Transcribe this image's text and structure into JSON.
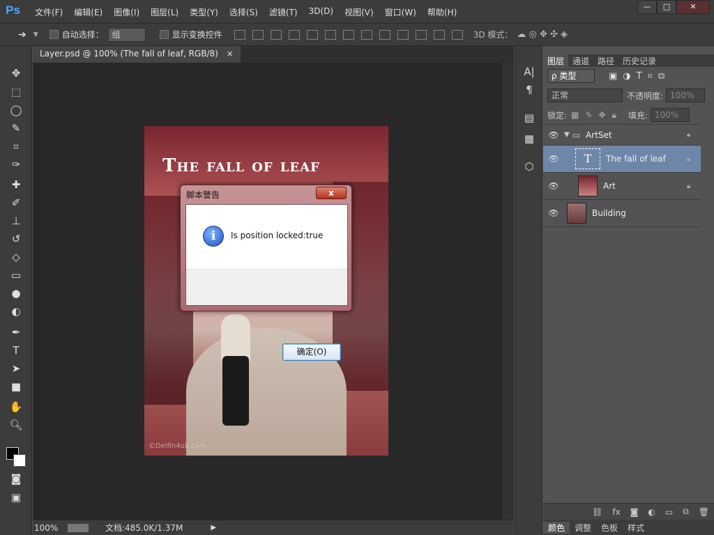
{
  "app": {
    "logo": "Ps"
  },
  "menu": [
    "文件(F)",
    "编辑(E)",
    "图像(I)",
    "图层(L)",
    "类型(Y)",
    "选择(S)",
    "滤镜(T)",
    "3D(D)",
    "视图(V)",
    "窗口(W)",
    "帮助(H)"
  ],
  "window_controls": {
    "minimize": "—",
    "maximize": "□",
    "close": "✕"
  },
  "options": {
    "auto_select_label": "自动选择：",
    "auto_select_value": "组",
    "show_transform_label": "显示变换控件",
    "mode_3d_label": "3D 模式："
  },
  "document": {
    "tab_title": "Layer.psd @ 100% (The fall of leaf, RGB/8)",
    "tab_close": "×",
    "image_title": "The fall of leaf",
    "watermark": "©Delfin4uk.com"
  },
  "status": {
    "zoom": "100%",
    "doc_info": "文档:485.0K/1.37M"
  },
  "panel": {
    "tabs": [
      "图层",
      "通道",
      "路径",
      "历史记录"
    ],
    "filter_kind": "ρ 类型",
    "blend_mode": "正常",
    "opacity_label": "不透明度:",
    "opacity_value": "100%",
    "lock_label": "锁定:",
    "fill_label": "填充:",
    "fill_value": "100%",
    "layers": [
      {
        "name": "ArtSet",
        "type": "group",
        "locked": true
      },
      {
        "name": "The fall of leaf",
        "type": "text",
        "locked": true,
        "selected": true
      },
      {
        "name": "Art",
        "type": "image",
        "locked": true
      },
      {
        "name": "Building",
        "type": "image",
        "locked": false
      }
    ],
    "bottom_tabs": [
      "颜色",
      "调整",
      "色板",
      "样式"
    ]
  },
  "dialog": {
    "title": "脚本警告",
    "close": "x",
    "icon": "i",
    "message": "Is position locked:true",
    "ok_label": "确定(O)"
  },
  "colors": {
    "selection": "#6e86a8",
    "accent": "#4aa8ff"
  }
}
